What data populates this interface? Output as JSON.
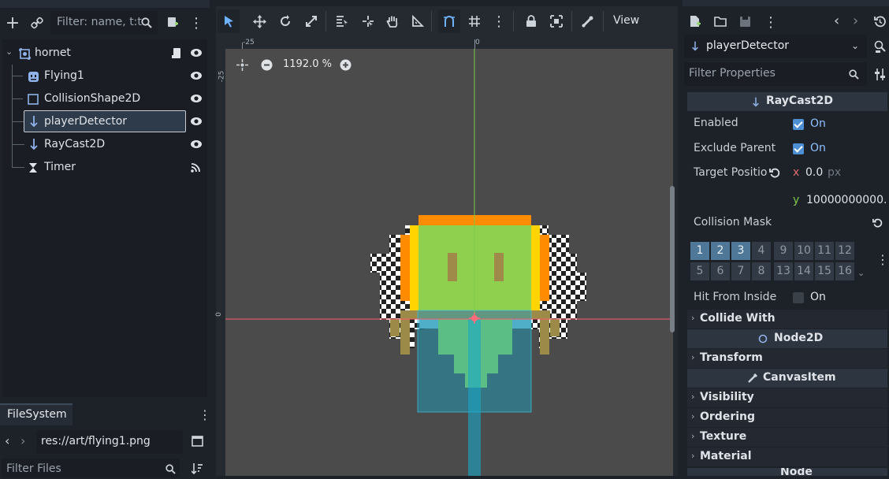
{
  "scene_dock": {
    "filter_placeholder": "Filter: name, t:t",
    "nodes": [
      {
        "label": "hornet",
        "icon": "node2d-icon"
      },
      {
        "label": "Flying1",
        "icon": "sprite-icon"
      },
      {
        "label": "CollisionShape2D",
        "icon": "collision-shape-icon"
      },
      {
        "label": "playerDetector",
        "icon": "raycast-icon"
      },
      {
        "label": "RayCast2D",
        "icon": "raycast-icon"
      },
      {
        "label": "Timer",
        "icon": "timer-icon"
      }
    ]
  },
  "filesystem": {
    "tab_label": "FileSystem",
    "path": "res://art/flying1.png",
    "filter_placeholder": "Filter Files"
  },
  "viewport": {
    "zoom": "1192.0 %",
    "view_menu": "View",
    "ruler_top_ticks": [
      "-25",
      "0"
    ],
    "ruler_left_ticks": [
      "-25",
      "0"
    ]
  },
  "inspector": {
    "node_name": "playerDetector",
    "filter_placeholder": "Filter Properties",
    "class_header": "RayCast2D",
    "props": {
      "enabled_label": "Enabled",
      "enabled_value": "On",
      "exclude_parent_label": "Exclude Parent",
      "exclude_parent_value": "On",
      "target_position_label": "Target Positio",
      "target_x_axis": "x",
      "target_x_value": "0.0",
      "target_x_unit": "px",
      "target_y_axis": "y",
      "target_y_value": "10000000000.",
      "collision_mask_label": "Collision Mask",
      "hit_from_inside_label": "Hit From Inside",
      "hit_from_inside_value": "On"
    },
    "mask_bits_row1": [
      "1",
      "2",
      "3",
      "4",
      "9",
      "10",
      "11",
      "12"
    ],
    "mask_bits_row2": [
      "5",
      "6",
      "7",
      "8",
      "13",
      "14",
      "15",
      "16"
    ],
    "mask_bits_active": [
      "1",
      "2",
      "3"
    ],
    "collide_with_label": "Collide With",
    "node2d_header": "Node2D",
    "transform_label": "Transform",
    "canvasitem_header": "CanvasItem",
    "visibility_label": "Visibility",
    "ordering_label": "Ordering",
    "texture_label": "Texture",
    "material_label": "Material",
    "node_header": "Node"
  },
  "colors": {
    "accent": "#4e8fd4",
    "selected_row": "#2e3b4b",
    "canvas_bg": "#4b4b4b"
  }
}
